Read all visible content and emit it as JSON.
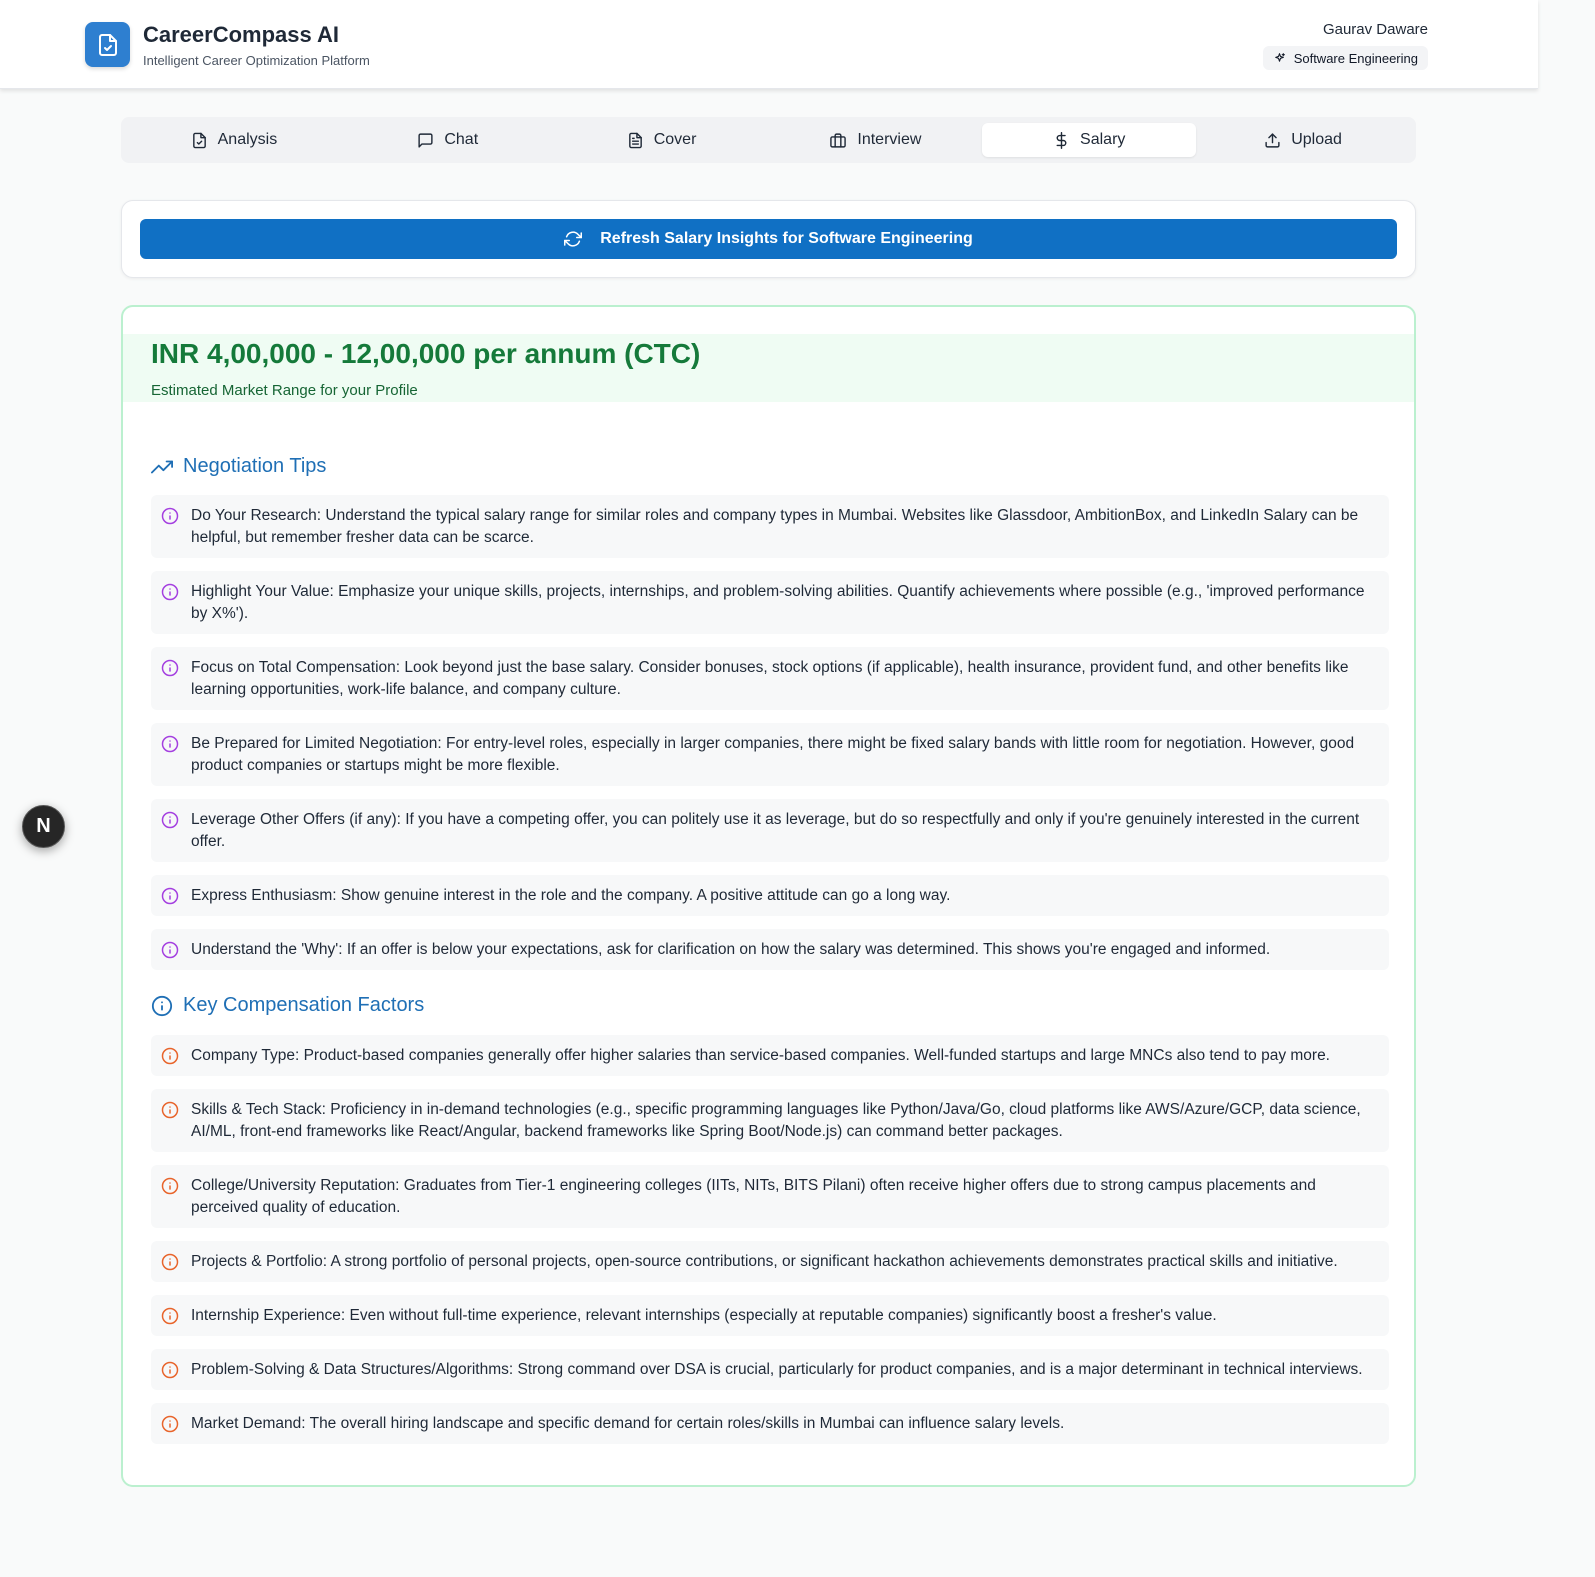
{
  "header": {
    "title": "CareerCompass AI",
    "subtitle": "Intelligent Career Optimization Platform",
    "user_name": "Gaurav Daware",
    "badge": "Software Engineering"
  },
  "tabs": [
    {
      "label": "Analysis",
      "icon": "file-check-icon"
    },
    {
      "label": "Chat",
      "icon": "message-icon"
    },
    {
      "label": "Cover",
      "icon": "document-icon"
    },
    {
      "label": "Interview",
      "icon": "briefcase-icon"
    },
    {
      "label": "Salary",
      "icon": "dollar-icon",
      "active": true
    },
    {
      "label": "Upload",
      "icon": "upload-icon"
    }
  ],
  "refresh": {
    "label": "Refresh Salary Insights for Software Engineering"
  },
  "salary": {
    "range": "INR 4,00,000 - 12,00,000 per annum (CTC)",
    "range_label": "Estimated Market Range for your Profile"
  },
  "negotiation": {
    "title": "Negotiation Tips",
    "items": [
      "Do Your Research: Understand the typical salary range for similar roles and company types in Mumbai. Websites like Glassdoor, AmbitionBox, and LinkedIn Salary can be helpful, but remember fresher data can be scarce.",
      "Highlight Your Value: Emphasize your unique skills, projects, internships, and problem-solving abilities. Quantify achievements where possible (e.g., 'improved performance by X%').",
      "Focus on Total Compensation: Look beyond just the base salary. Consider bonuses, stock options (if applicable), health insurance, provident fund, and other benefits like learning opportunities, work-life balance, and company culture.",
      "Be Prepared for Limited Negotiation: For entry-level roles, especially in larger companies, there might be fixed salary bands with little room for negotiation. However, good product companies or startups might be more flexible.",
      "Leverage Other Offers (if any): If you have a competing offer, you can politely use it as leverage, but do so respectfully and only if you're genuinely interested in the current offer.",
      "Express Enthusiasm: Show genuine interest in the role and the company. A positive attitude can go a long way.",
      "Understand the 'Why': If an offer is below your expectations, ask for clarification on how the salary was determined. This shows you're engaged and informed."
    ]
  },
  "factors": {
    "title": "Key Compensation Factors",
    "items": [
      "Company Type: Product-based companies generally offer higher salaries than service-based companies. Well-funded startups and large MNCs also tend to pay more.",
      "Skills & Tech Stack: Proficiency in in-demand technologies (e.g., specific programming languages like Python/Java/Go, cloud platforms like AWS/Azure/GCP, data science, AI/ML, front-end frameworks like React/Angular, backend frameworks like Spring Boot/Node.js) can command better packages.",
      "College/University Reputation: Graduates from Tier-1 engineering colleges (IITs, NITs, BITS Pilani) often receive higher offers due to strong campus placements and perceived quality of education.",
      "Projects & Portfolio: A strong portfolio of personal projects, open-source contributions, or significant hackathon achievements demonstrates practical skills and initiative.",
      "Internship Experience: Even without full-time experience, relevant internships (especially at reputable companies) significantly boost a fresher's value.",
      "Problem-Solving & Data Structures/Algorithms: Strong command over DSA is crucial, particularly for product companies, and is a major determinant in technical interviews.",
      "Market Demand: The overall hiring landscape and specific demand for certain roles/skills in Mumbai can influence salary levels."
    ]
  },
  "fab": {
    "label": "N"
  },
  "colors": {
    "primary": "#1070c4",
    "salary_green": "#157a3a",
    "tip_icon": "#a43fe0",
    "factor_icon": "#e8642b",
    "section_title": "#1f6fb5"
  }
}
